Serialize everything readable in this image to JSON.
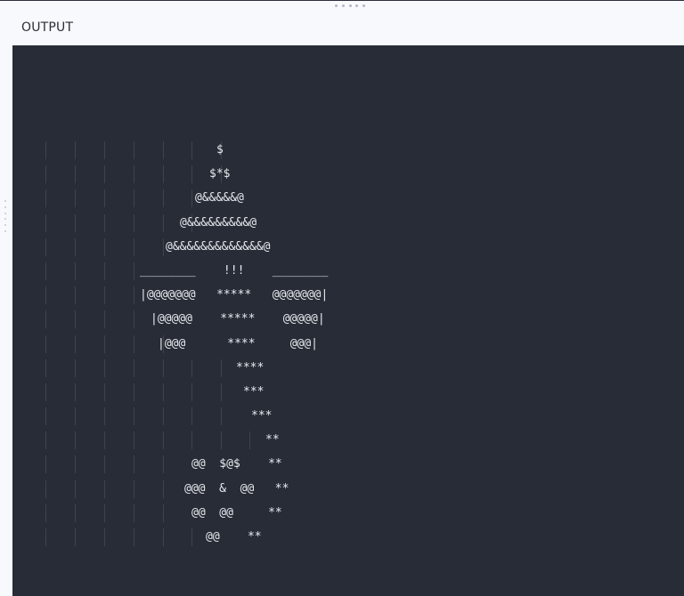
{
  "panel": {
    "title": "OUTPUT"
  },
  "console": {
    "lines": [
      {
        "indent": 229,
        "text": "$",
        "guides": 7
      },
      {
        "indent": 221,
        "text": "$*$",
        "guides": 7
      },
      {
        "indent": 205,
        "text": "@&&&&&@",
        "guides": 6
      },
      {
        "indent": 188,
        "text": "@&&&&&&&&&@",
        "guides": 6
      },
      {
        "indent": 172,
        "text": "@&&&&&&&&&&&&&@",
        "guides": 5
      },
      {
        "indent": 143,
        "text": "________    !!!    ________",
        "guides": 4
      },
      {
        "indent": 143,
        "text": "|@@@@@@@   *****   @@@@@@@|",
        "guides": 4
      },
      {
        "indent": 155,
        "text": "|@@@@@    *****    @@@@@|",
        "guides": 4
      },
      {
        "indent": 163,
        "text": "|@@@      ****     @@@|",
        "guides": 5
      },
      {
        "indent": 251,
        "text": "****",
        "guides": 7
      },
      {
        "indent": 259,
        "text": "***",
        "guides": 7
      },
      {
        "indent": 268,
        "text": "***",
        "guides": 7
      },
      {
        "indent": 284,
        "text": "**",
        "guides": 8
      },
      {
        "indent": 201,
        "text": "@@  $@$    **",
        "guides": 5
      },
      {
        "indent": 193,
        "text": "@@@  &  @@   **",
        "guides": 5
      },
      {
        "indent": 201,
        "text": "@@  @@     **",
        "guides": 5
      },
      {
        "indent": 217,
        "text": "@@    **",
        "guides": 6
      }
    ]
  }
}
